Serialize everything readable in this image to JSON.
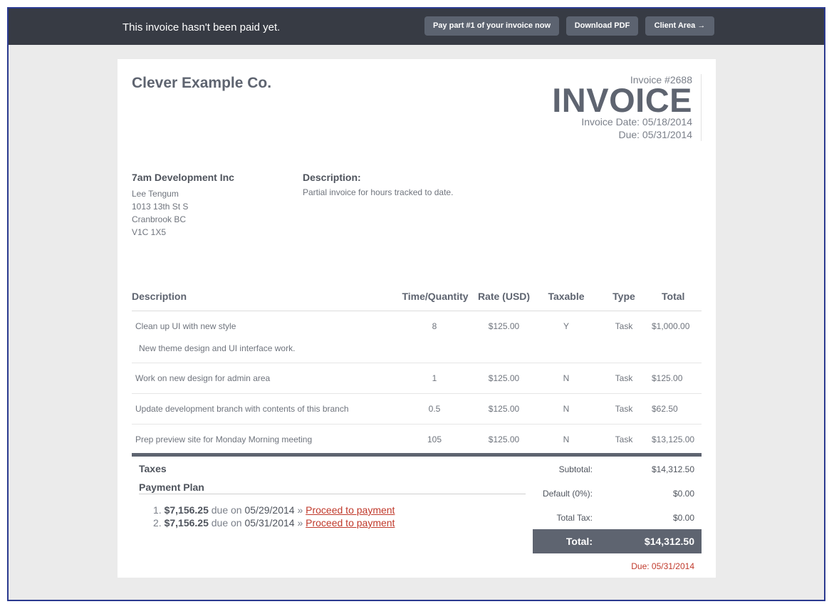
{
  "topbar": {
    "message": "This invoice hasn't been paid yet.",
    "pay_button": "Pay part #1 of your invoice now",
    "pdf_button": "Download PDF",
    "client_button": "Client Area →"
  },
  "company": "Clever Example Co.",
  "invoice": {
    "number": "Invoice #2688",
    "title": "INVOICE",
    "date": "Invoice Date: 05/18/2014",
    "due": "Due: 05/31/2014"
  },
  "client": {
    "name": "7am Development Inc",
    "contact": "Lee Tengum",
    "street": "1013 13th St S",
    "city": "Cranbrook BC",
    "postal": "V1C 1X5"
  },
  "description": {
    "label": "Description:",
    "text": "Partial invoice for hours tracked to date."
  },
  "table": {
    "headers": {
      "description": "Description",
      "quantity": "Time/Quantity",
      "rate": "Rate (USD)",
      "taxable": "Taxable",
      "type": "Type",
      "total": "Total"
    },
    "rows": [
      {
        "description": "Clean up UI with new style",
        "quantity": "8",
        "rate": "$125.00",
        "taxable": "Y",
        "type": "Task",
        "total": "$1,000.00",
        "note": "New theme design and UI interface work."
      },
      {
        "description": "Work on new design for admin area",
        "quantity": "1",
        "rate": "$125.00",
        "taxable": "N",
        "type": "Task",
        "total": "$125.00"
      },
      {
        "description": "Update development branch with contents of this branch",
        "quantity": "0.5",
        "rate": "$125.00",
        "taxable": "N",
        "type": "Task",
        "total": "$62.50"
      },
      {
        "description": "Prep preview site for Monday Morning meeting",
        "quantity": "105",
        "rate": "$125.00",
        "taxable": "N",
        "type": "Task",
        "total": "$13,125.00"
      }
    ]
  },
  "taxes_label": "Taxes",
  "payment_plan": {
    "label": "Payment Plan",
    "items": [
      {
        "num": "1.",
        "amount": "$7,156.25",
        "due_word": "due on",
        "date": "05/29/2014",
        "sep": "»",
        "link": "Proceed to payment"
      },
      {
        "num": "2.",
        "amount": "$7,156.25",
        "due_word": "due on",
        "date": "05/31/2014",
        "sep": "»",
        "link": "Proceed to payment"
      }
    ]
  },
  "summary": {
    "subtotal_label": "Subtotal:",
    "subtotal": "$14,312.50",
    "default_label": "Default (0%):",
    "default": "$0.00",
    "tax_label": "Total Tax:",
    "tax": "$0.00",
    "total_label": "Total:",
    "total": "$14,312.50",
    "due": "Due: 05/31/2014"
  },
  "colors": {
    "topbar": "#373b44",
    "button": "#5c6370",
    "accent_dark": "#5e6470",
    "link_red": "#c0392b",
    "frame_border": "#2b3a8f"
  }
}
